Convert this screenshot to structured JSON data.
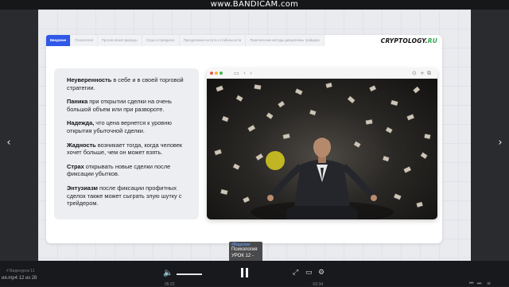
{
  "recorder": {
    "watermark": "www.BANDICAM.com"
  },
  "tabs": [
    {
      "label": "Введение",
      "active": true
    },
    {
      "label": "Психология",
      "active": false
    },
    {
      "label": "Против своей природы",
      "active": false
    },
    {
      "label": "Страх в трейдинге",
      "active": false
    },
    {
      "label": "Преодоление на пути к стабильности",
      "active": false
    },
    {
      "label": "Практические методы дисциплины трейдера",
      "active": false
    }
  ],
  "logo": {
    "main": "CRYPTOLOGY.",
    "accent": "RU"
  },
  "paragraphs": [
    {
      "term": "Неуверенность",
      "text": " в себе и в своей торговой стратегии."
    },
    {
      "term": "Паника",
      "text": " при открытии сделки на очень большой объем или при развороте."
    },
    {
      "term": "Надежда,",
      "text": " что цена вернется к уровню открытия убыточной сделки."
    },
    {
      "term": "Жадность",
      "text": " возникает тогда, когда человек хочет больше, чем он может взять."
    },
    {
      "term": "Страх",
      "text": " открывать новые сделки после фиксации убытков."
    },
    {
      "term": "Энтузиазм",
      "text": " после фиксации профитных сделок также может сыграть злую шутку с трейдером."
    }
  ],
  "browser": {
    "dots": [
      "#e8584c",
      "#f1b52c",
      "#47b64b"
    ],
    "image_alt_icon": "meditating-man-with-flying-cards-image"
  },
  "tooltip": {
    "source": "#Видеомо",
    "line1": "Психология",
    "line2": "УРОК 12 -"
  },
  "player": {
    "file_label": "ия.mp4 12 из 28",
    "file_label_top": "# Видеоурок 11",
    "time_current": "05:22",
    "time_total": "-02:34",
    "accent": "#ffffff"
  }
}
